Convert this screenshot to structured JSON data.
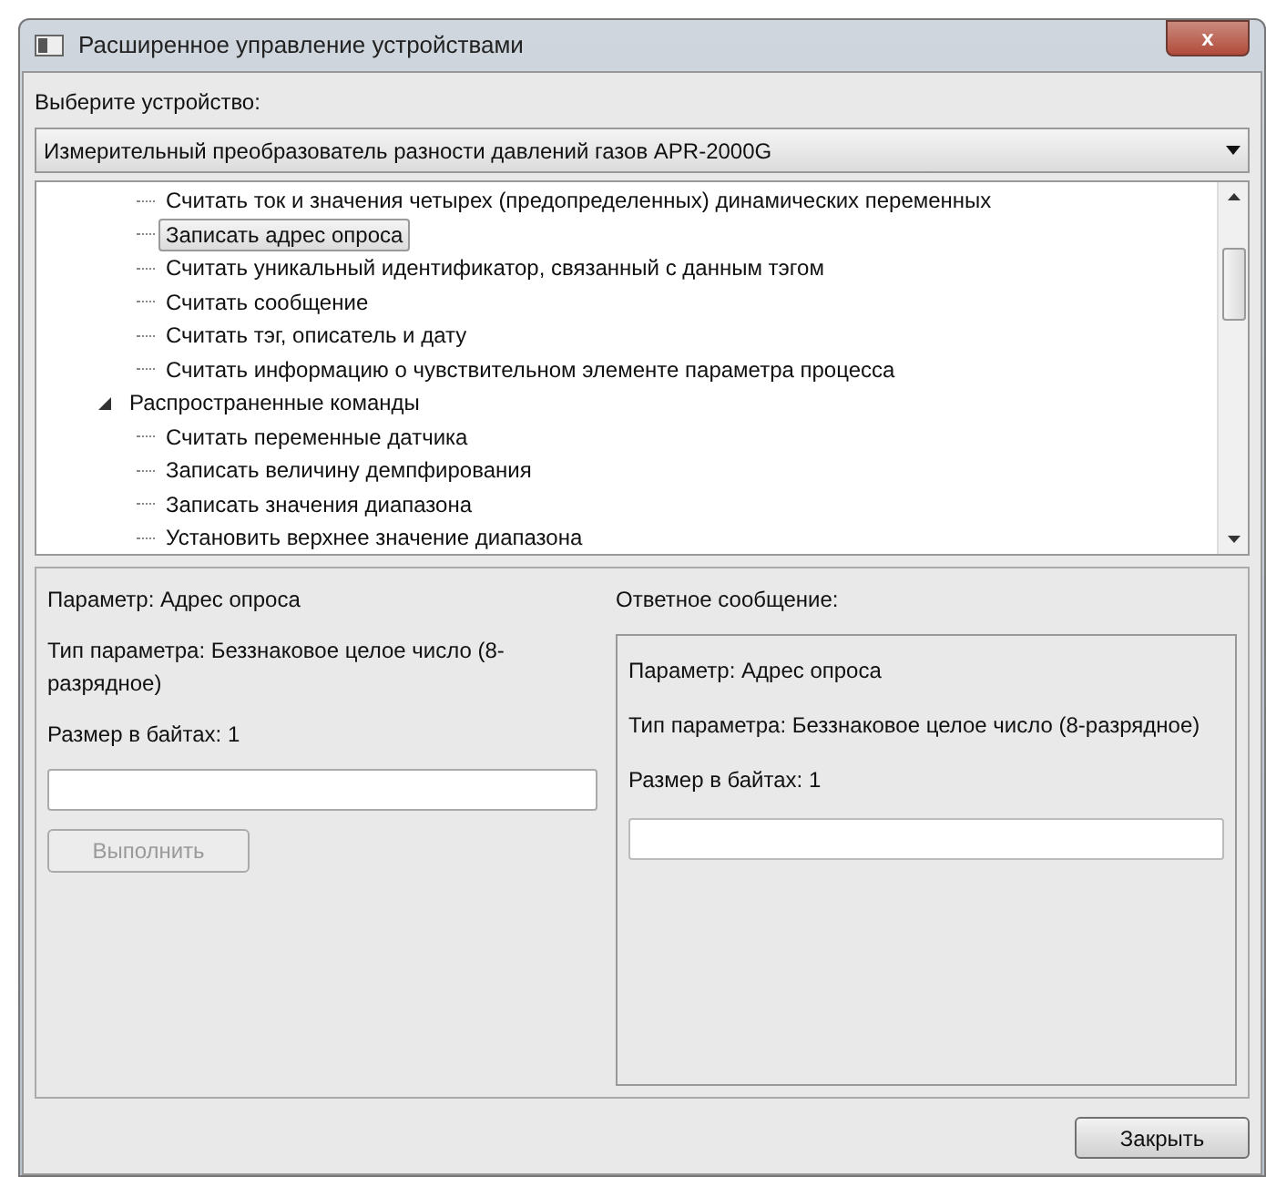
{
  "window": {
    "title": "Расширенное управление устройствами",
    "close": "x"
  },
  "device_label": "Выберите устройство:",
  "device_select": {
    "value": "Измерительный преобразователь разности давлений газов APR-2000G"
  },
  "tree": [
    {
      "children": [
        {
          "label": "Считать ток и значения четырех (предопределенных) динамических переменных",
          "selected": false
        },
        {
          "label": "Записать адрес опроса",
          "selected": true
        },
        {
          "label": "Считать уникальный идентификатор, связанный с данным тэгом",
          "selected": false
        },
        {
          "label": "Считать сообщение",
          "selected": false
        },
        {
          "label": "Считать тэг, описатель и дату",
          "selected": false
        },
        {
          "label": "Считать информацию о чувствительном элементе параметра процесса",
          "selected": false
        }
      ]
    },
    {
      "label": "Распространенные команды",
      "expanded": true,
      "children": [
        {
          "label": "Считать переменные датчика",
          "selected": false
        },
        {
          "label": "Записать величину демпфирования",
          "selected": false
        },
        {
          "label": "Записать значения диапазона",
          "selected": false
        },
        {
          "label": "Установить верхнее значение диапазона",
          "selected": false
        }
      ]
    }
  ],
  "parameter_panel": {
    "lines": [
      "Параметр: Адрес опроса",
      "Тип параметра: Беззнаковое целое число (8-разрядное)",
      "Размер в байтах: 1"
    ],
    "execute_button": {
      "label": "Выполнить",
      "disabled": true
    }
  },
  "response_panel": {
    "title": "Ответное сообщение:",
    "lines": [
      "Параметр: Адрес опроса",
      "Тип параметра: Беззнаковое целое число (8-разрядное)",
      "Размер в байтах: 1"
    ]
  },
  "close_button": "Закрыть"
}
